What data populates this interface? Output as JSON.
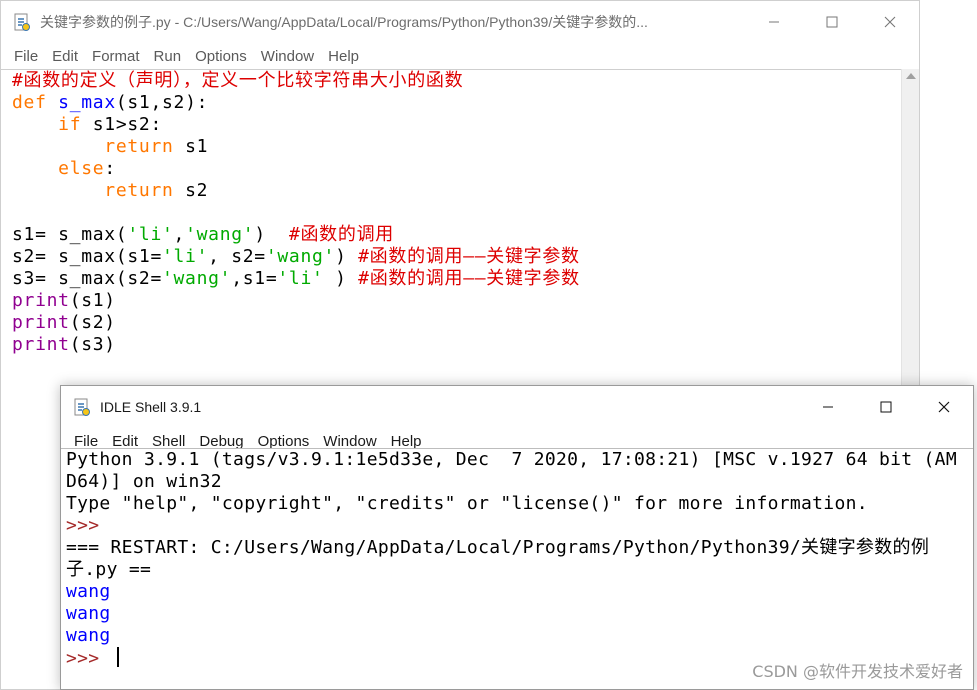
{
  "editor": {
    "title": "关键字参数的例子.py - C:/Users/Wang/AppData/Local/Programs/Python/Python39/关键字参数的...",
    "menu": [
      "File",
      "Edit",
      "Format",
      "Run",
      "Options",
      "Window",
      "Help"
    ],
    "code": {
      "l1": "#函数的定义（声明），定义一个比较字符串大小的函数",
      "l2_kw": "def",
      "l2_name": "s_max",
      "l2_rest": "(s1,s2):",
      "l3_indent": "    ",
      "l3_kw": "if",
      "l3_rest": " s1>s2:",
      "l4_indent": "        ",
      "l4_kw": "return",
      "l4_rest": " s1",
      "l5_indent": "    ",
      "l5_kw": "else",
      "l5_rest": ":",
      "l6_indent": "        ",
      "l6_kw": "return",
      "l6_rest": " s2",
      "l8_a": "s1= s_max(",
      "l8_s1": "'li'",
      "l8_b": ",",
      "l8_s2": "'wang'",
      "l8_c": ")  ",
      "l8_cm": "#函数的调用",
      "l9_a": "s2= s_max(s1=",
      "l9_s1": "'li'",
      "l9_b": ", s2=",
      "l9_s2": "'wang'",
      "l9_c": ") ",
      "l9_cm": "#函数的调用——关键字参数",
      "l10_a": "s3= s_max(s2=",
      "l10_s1": "'wang'",
      "l10_b": ",s1=",
      "l10_s2": "'li'",
      "l10_c": " ) ",
      "l10_cm": "#函数的调用——关键字参数",
      "l11_fn": "print",
      "l11_rest": "(s1)",
      "l12_fn": "print",
      "l12_rest": "(s2)",
      "l13_fn": "print",
      "l13_rest": "(s3)"
    }
  },
  "shell": {
    "title": "IDLE Shell 3.9.1",
    "menu": [
      "File",
      "Edit",
      "Shell",
      "Debug",
      "Options",
      "Window",
      "Help"
    ],
    "lines": {
      "banner1": "Python 3.9.1 (tags/v3.9.1:1e5d33e, Dec  7 2020, 17:08:21) [MSC v.1927 64 bit (AM",
      "banner2": "D64)] on win32",
      "banner3": "Type \"help\", \"copyright\", \"credits\" or \"license()\" for more information.",
      "prompt1": ">>> ",
      "restart1": "=== RESTART: C:/Users/Wang/AppData/Local/Programs/Python/Python39/关键字参数的例",
      "restart2": "子.py ==",
      "out1": "wang",
      "out2": "wang",
      "out3": "wang",
      "prompt2": ">>> "
    }
  },
  "watermark": "CSDN @软件开发技术爱好者",
  "colors": {
    "comment": "#dd0000",
    "keyword": "#ff7700",
    "definition": "#0000ff",
    "string": "#00aa00",
    "builtin": "#900090",
    "stdout": "#0000ff",
    "prompt": "#a52a2a"
  }
}
